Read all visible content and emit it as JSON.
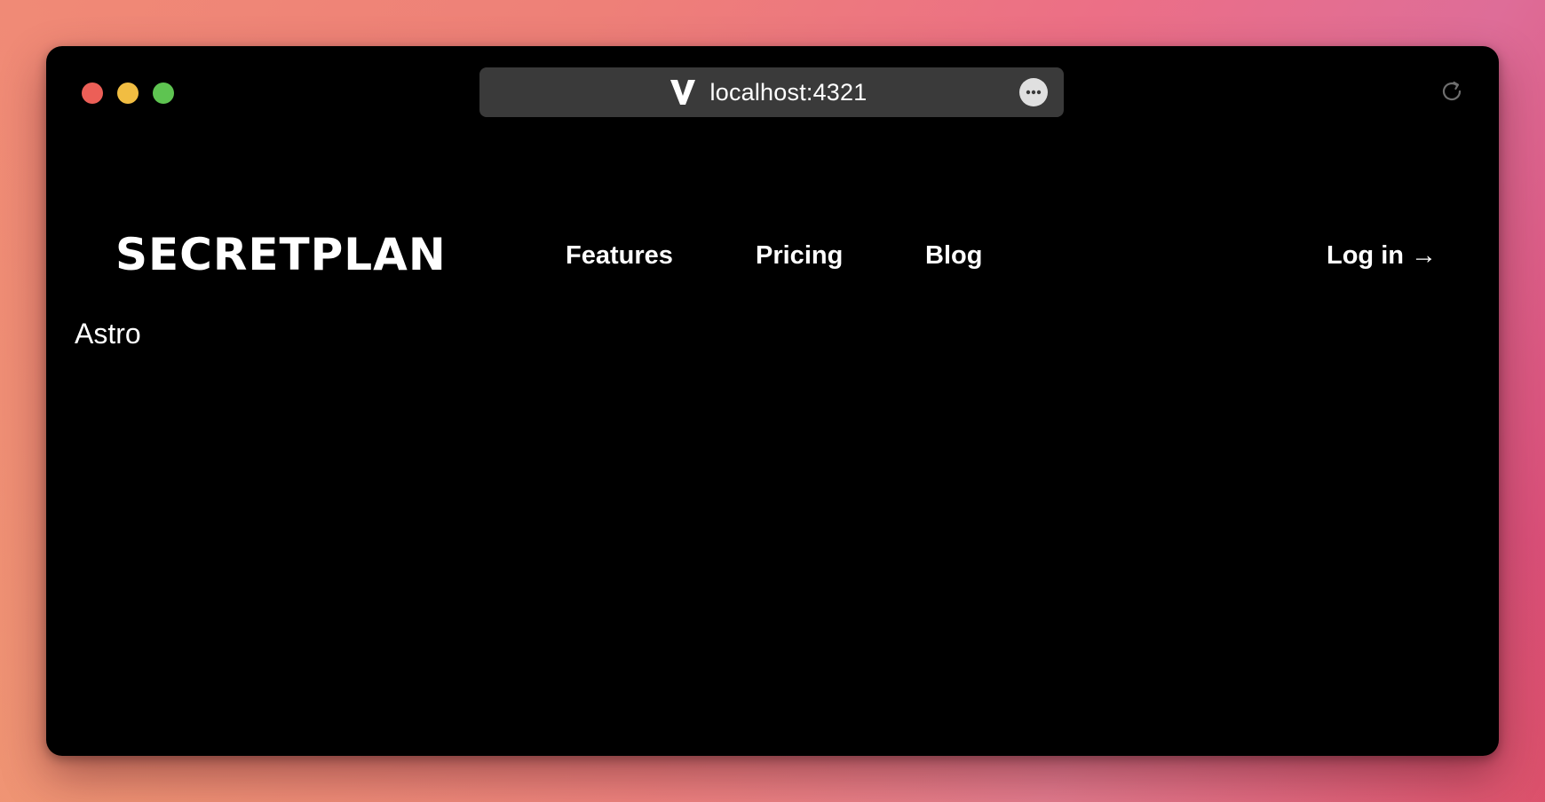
{
  "browser": {
    "url": "localhost:4321",
    "logo_icon": "vite-v-logo-icon",
    "more_icon": "ellipsis-icon",
    "reload_icon": "reload-icon",
    "traffic_colors": {
      "close": "#ec5f57",
      "minimize": "#f1bd42",
      "maximize": "#5ec451"
    }
  },
  "header": {
    "logo": "SECRETPLAN",
    "nav": {
      "features": "Features",
      "pricing": "Pricing",
      "blog": "Blog"
    },
    "login": "Log in →"
  },
  "main": {
    "text": "Astro"
  },
  "colors": {
    "page_background": "#000000",
    "text": "#ffffff",
    "urlbar_background": "#3a3a3a"
  }
}
